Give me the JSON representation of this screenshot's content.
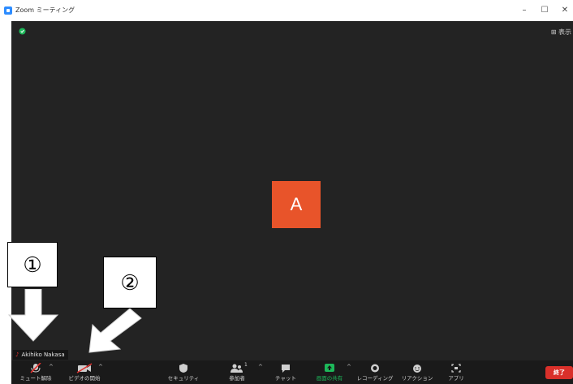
{
  "window": {
    "title": "Zoom ミーティング",
    "controls": [
      "–",
      "☐",
      "✕"
    ]
  },
  "stage": {
    "view_toggle": "⊞ 表示",
    "avatar_letter": "A",
    "participant_name": "Akihiko Nakasa",
    "colors": {
      "avatar_bg": "#e8542a",
      "stage_bg": "#232323",
      "security_green": "#1db85a"
    }
  },
  "toolbar": {
    "unmute": "ミュート解除",
    "start_video": "ビデオの開始",
    "security": "セキュリティ",
    "participants": "参加者",
    "participants_count": "1",
    "chat": "チャット",
    "share_screen": "画面の共有",
    "recording": "レコーディング",
    "reactions": "リアクション",
    "apps": "アプリ",
    "end": "終了",
    "caret": "^"
  },
  "annotations": {
    "label_1": "①",
    "label_2": "②"
  }
}
